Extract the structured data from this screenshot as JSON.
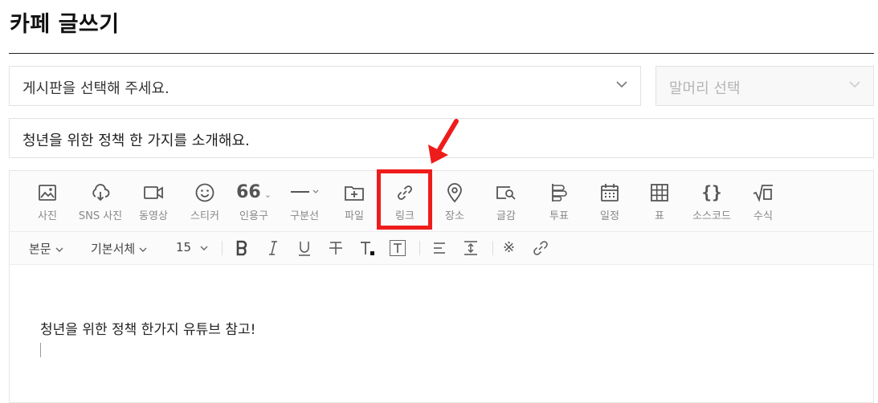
{
  "page": {
    "title": "카페 글쓰기"
  },
  "board_select": {
    "value": "게시판을 선택해 주세요."
  },
  "header_select": {
    "placeholder": "말머리 선택"
  },
  "post_title": {
    "value": "청년을 위한 정책 한 가지를 소개해요."
  },
  "toolbar": {
    "tools": [
      {
        "label": "사진",
        "icon": "photo-icon"
      },
      {
        "label": "SNS 사진",
        "icon": "cloud-download-icon"
      },
      {
        "label": "동영상",
        "icon": "video-icon"
      },
      {
        "label": "스티커",
        "icon": "smiley-icon"
      },
      {
        "label": "인용구",
        "icon": "quote-icon"
      },
      {
        "label": "구분선",
        "icon": "divider-icon"
      },
      {
        "label": "파일",
        "icon": "folder-plus-icon"
      },
      {
        "label": "링크",
        "icon": "link-icon"
      },
      {
        "label": "장소",
        "icon": "map-pin-icon"
      },
      {
        "label": "글감",
        "icon": "search-material-icon"
      },
      {
        "label": "투표",
        "icon": "poll-icon"
      },
      {
        "label": "일정",
        "icon": "calendar-icon"
      },
      {
        "label": "표",
        "icon": "table-icon"
      },
      {
        "label": "소스코드",
        "icon": "braces-icon"
      },
      {
        "label": "수식",
        "icon": "sqrt-icon"
      }
    ],
    "quote_glyph": "66"
  },
  "format_bar": {
    "paragraph_style": "본문",
    "font": "기본서체",
    "font_size": "15",
    "special_char": "※"
  },
  "body": {
    "text": "청년을 위한 정책 한가지 유튜브 참고!"
  },
  "annotation": {
    "color": "#ef1c1c"
  }
}
